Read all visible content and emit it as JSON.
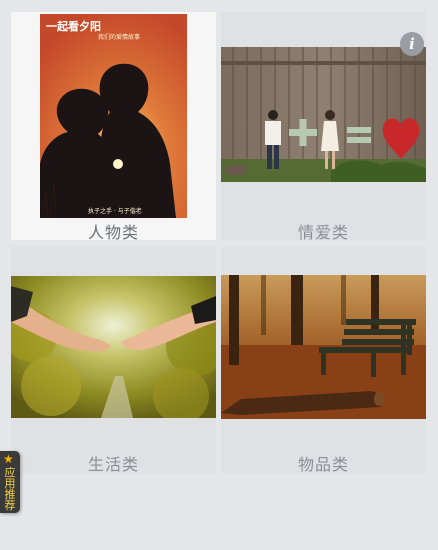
{
  "categories": [
    {
      "key": "people",
      "label": "人物类",
      "selected": true
    },
    {
      "key": "love",
      "label": "情爱类",
      "selected": false
    },
    {
      "key": "life",
      "label": "生活类",
      "selected": false
    },
    {
      "key": "goods",
      "label": "物品类",
      "selected": false
    }
  ],
  "poster": {
    "title": "一起看夕阳",
    "subtitle": "我们的爱情故事",
    "caption": "执子之手 · 与子偕老"
  },
  "info_button": {
    "symbol": "i"
  },
  "side_tab": {
    "icon": "star-icon",
    "label": "应用推荐"
  },
  "colors": {
    "background": "#e4e6e9",
    "card": "#dfe1e4",
    "selected_card": "#f6f6f6",
    "label_text": "#8b8f93",
    "tab_bg": "#3a3a3a",
    "tab_star": "#f2b300"
  }
}
